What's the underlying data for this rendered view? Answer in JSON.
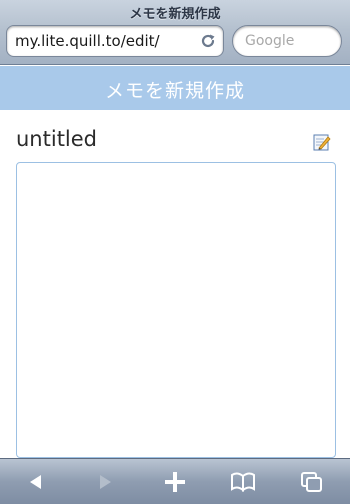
{
  "browser": {
    "window_title": "メモを新規作成",
    "url": "my.lite.quill.to/edit/",
    "search_placeholder": "Google"
  },
  "page": {
    "header_title": "メモを新規作成",
    "memo_title": "untitled",
    "memo_body": ""
  },
  "toolbar": {
    "buttons": [
      "back-icon",
      "forward-icon",
      "add-icon",
      "bookmarks-icon",
      "pages-icon"
    ]
  },
  "colors": {
    "header_bg": "#a9c9ea",
    "textarea_border": "#9cc0e3"
  }
}
